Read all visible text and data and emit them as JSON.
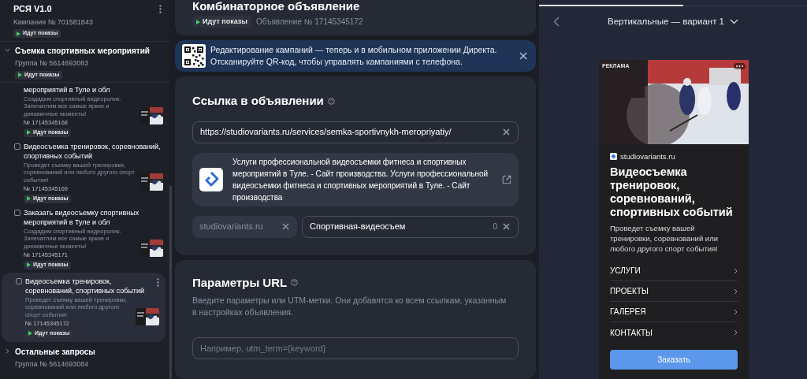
{
  "sidebar": {
    "campaign": {
      "title": "РСЯ V1.0",
      "number": "Кампания № 701581843",
      "status": "Идут показы"
    },
    "groups": [
      {
        "title": "Съемка спортивных мероприятий",
        "number": "Группа № 5614693083",
        "status": "Идут показы",
        "expanded": true,
        "ads": [
          {
            "kind": "partial",
            "title": "мероприятий в Туле и обл",
            "description": "Создадим спортивный видеоролик. Запечатлим все самые яркие и динамичные моменты!",
            "number": "№ 17145345168",
            "status": "Идут показы",
            "selected": false
          },
          {
            "kind": "full",
            "checked": false,
            "title": "Видеосъемка тренировок, соревнований, спортивных событий",
            "description": "Проведет съемку вашей тренировки, соревнований или любого другого спорт события!",
            "number": "№ 17145345169",
            "status": "Идут показы",
            "selected": false
          },
          {
            "kind": "full",
            "checked": false,
            "title": "Заказать видеосъемку спортивных мероприятий в Туле и обл",
            "description": "Создадим спортивный видеоролик. Запечатлим все самые яркие и динамичные моменты!",
            "number": "№ 17145345171",
            "status": "Идут показы",
            "selected": false
          },
          {
            "kind": "full",
            "checked": false,
            "title": "Видеосъемка тренировок, соревнований, спортивных событий",
            "description": "Проведет съемку вашей тренировки, соревнований или любого другого спорт события!",
            "number": "№ 17145345172",
            "status": "Идут показы",
            "selected": true
          }
        ]
      },
      {
        "title": "Остальные запросы",
        "number": "Группа № 5614693084",
        "expanded": false
      }
    ]
  },
  "main": {
    "header": {
      "title": "Комбинаторное объявление",
      "status": "Идут показы",
      "ad_number": "Объявление № 17145345172"
    },
    "banner": {
      "text": "Редактирование кампаний — теперь и в мобильном приложении Директа. Отсканируйте QR-код, чтобы управлять кампаниями с телефона."
    },
    "link_section": {
      "title": "Ссылка в объявлении",
      "url": "https://studiovariants.ru/services/semka-sportivnykh-meropriyatiy/",
      "site_card": {
        "text": "Услуги профессиональной видеосъемки фитнеса и спортивных мероприятий в Туле. - Сайт производства. Услуги профессиональной видеосъемки фитнеса и спортивных мероприятий в Туле. - Сайт производства"
      },
      "display_link": {
        "domain": "studiovariants.ru",
        "path": "Спортивная-видеосъем",
        "counter": "0"
      }
    },
    "url_params": {
      "title": "Параметры URL",
      "description": "Введите параметры или UTM-метки. Они добавятся ко всем ссылкам, указанным в настройках объявления.",
      "placeholder": "Например, utm_term={keyword}"
    }
  },
  "preview": {
    "tabs": [
      {
        "selected": true
      },
      {
        "selected": false
      }
    ],
    "title": "Вертикальные — вариант 1",
    "ad": {
      "label": "РЕКЛАМА",
      "domain": "studiovariants.ru",
      "headline": "Видеосъемка тренировок, соревнований, спортивных событий",
      "text": "Проведет съемку вашей тренировки, соревнований или любого другого спорт события!",
      "links": [
        "УСЛУГИ",
        "ПРОЕКТЫ",
        "ГАЛЕРЕЯ",
        "КОНТАКТЫ"
      ],
      "button": "Заказать"
    }
  }
}
